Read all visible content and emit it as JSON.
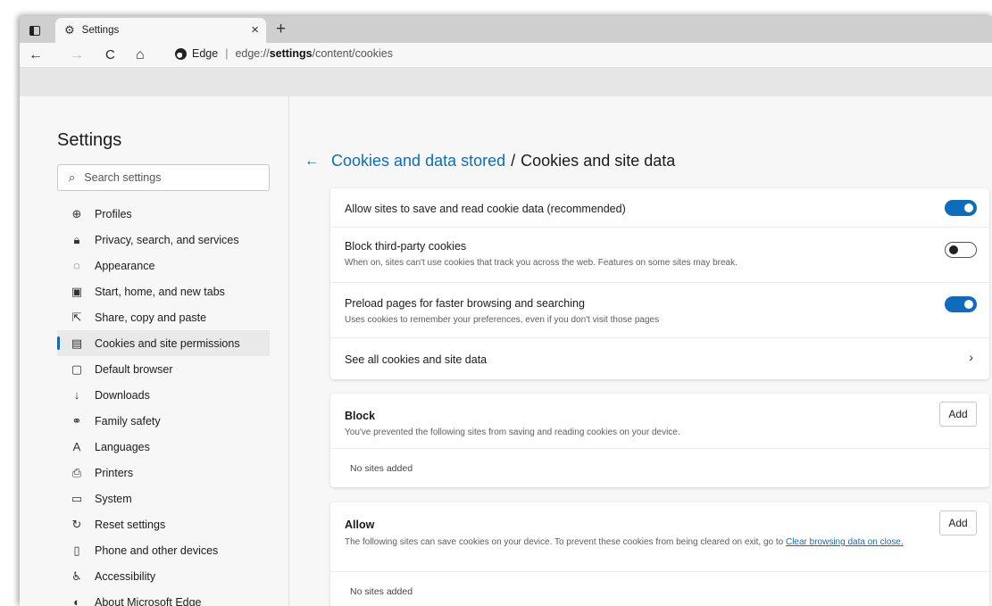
{
  "tabstrip": {
    "tab_title": "Settings",
    "close_glyph": "×",
    "new_tab_glyph": "+"
  },
  "toolbar": {
    "back_glyph": "←",
    "forward_glyph": "→",
    "refresh_glyph": "C",
    "home_glyph": "⌂",
    "brand": "Edge",
    "separator": "|",
    "url_prefix": "edge://",
    "url_strong": "settings",
    "url_suffix": "/content/cookies"
  },
  "sidebar": {
    "title": "Settings",
    "search_placeholder": "Search settings",
    "items": [
      {
        "label": "Profiles",
        "icon": "profile-icon",
        "glyph": "⊕"
      },
      {
        "label": "Privacy, search, and services",
        "icon": "lock-icon",
        "glyph": "🔒︎"
      },
      {
        "label": "Appearance",
        "icon": "palette-icon",
        "glyph": "◌"
      },
      {
        "label": "Start, home, and new tabs",
        "icon": "start-icon",
        "glyph": "▣"
      },
      {
        "label": "Share, copy and paste",
        "icon": "share-icon",
        "glyph": "⇱"
      },
      {
        "label": "Cookies and site permissions",
        "icon": "cookies-icon",
        "glyph": "▤"
      },
      {
        "label": "Default browser",
        "icon": "default-browser-icon",
        "glyph": "▢"
      },
      {
        "label": "Downloads",
        "icon": "download-icon",
        "glyph": "↓"
      },
      {
        "label": "Family safety",
        "icon": "family-icon",
        "glyph": "⚭"
      },
      {
        "label": "Languages",
        "icon": "languages-icon",
        "glyph": "A"
      },
      {
        "label": "Printers",
        "icon": "printer-icon",
        "glyph": "⎙"
      },
      {
        "label": "System",
        "icon": "system-icon",
        "glyph": "▭"
      },
      {
        "label": "Reset settings",
        "icon": "reset-icon",
        "glyph": "↻"
      },
      {
        "label": "Phone and other devices",
        "icon": "phone-icon",
        "glyph": "▯"
      },
      {
        "label": "Accessibility",
        "icon": "accessibility-icon",
        "glyph": "♿"
      },
      {
        "label": "About Microsoft Edge",
        "icon": "edge-icon",
        "glyph": "◐"
      }
    ],
    "active_index": 5
  },
  "main": {
    "back_glyph": "←",
    "breadcrumb_link": "Cookies and data stored",
    "breadcrumb_sep": "/",
    "breadcrumb_current": "Cookies and site data",
    "settings": [
      {
        "title": "Allow sites to save and read cookie data (recommended)",
        "desc": "",
        "toggle": "on"
      },
      {
        "title": "Block third-party cookies",
        "desc": "When on, sites can't use cookies that track you across the web. Features on some sites may break.",
        "toggle": "off"
      },
      {
        "title": "Preload pages for faster browsing and searching",
        "desc": "Uses cookies to remember your preferences, even if you don't visit those pages",
        "toggle": "on"
      },
      {
        "title": "See all cookies and site data",
        "desc": "",
        "chevron": "›"
      }
    ],
    "block": {
      "title": "Block",
      "desc": "You've prevented the following sites from saving and reading cookies on your device.",
      "add_label": "Add",
      "empty": "No sites added"
    },
    "allow": {
      "title": "Allow",
      "desc": "The following sites can save cookies on your device. To prevent these cookies from being cleared on exit, go to",
      "link": "Clear browsing data on close.",
      "add_label": "Add",
      "empty": "No sites added"
    }
  },
  "colors": {
    "accent": "#0f6cbd",
    "toggle_off_knob": "#222222"
  }
}
